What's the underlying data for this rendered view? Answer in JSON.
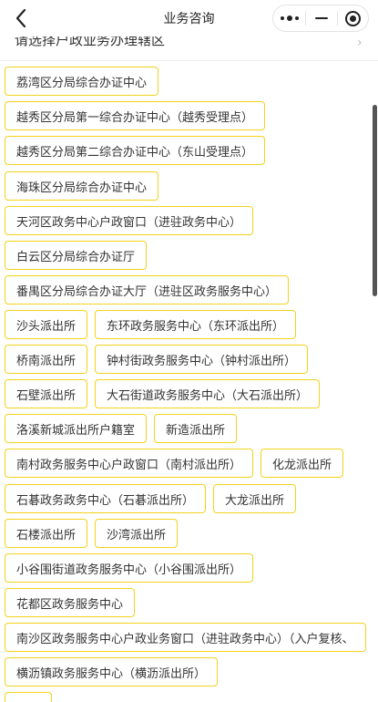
{
  "nav": {
    "title": "业务咨询"
  },
  "prompt": {
    "text": "请选择户政业务办理辖区",
    "arrow": "›"
  },
  "offices": [
    [
      "荔湾区分局综合办证中心"
    ],
    [
      "越秀区分局第一综合办证中心（越秀受理点）"
    ],
    [
      "越秀区分局第二综合办证中心（东山受理点）"
    ],
    [
      "海珠区分局综合办证中心"
    ],
    [
      "天河区政务中心户政窗口（进驻政务中心）"
    ],
    [
      "白云区分局综合办证厅"
    ],
    [
      "番禺区分局综合办证大厅（进驻区政务服务中心）"
    ],
    [
      "沙头派出所",
      "东环政务服务中心（东环派出所）"
    ],
    [
      "桥南派出所",
      "钟村街政务服务中心（钟村派出所）"
    ],
    [
      "石壁派出所",
      "大石街道政务服务中心（大石派出所）"
    ],
    [
      "洛溪新城派出所户籍室",
      "新造派出所"
    ],
    [
      "南村政务服务中心户政窗口（南村派出所）",
      "化龙派出所"
    ],
    [
      "石碁政务政务中心（石碁派出所）",
      "大龙派出所"
    ],
    [
      "石楼派出所",
      "沙湾派出所"
    ],
    [
      "小谷围街道政务服务中心（小谷围派出所）"
    ],
    [
      "花都区政务服务中心"
    ],
    [
      "南沙区政务服务中心户政业务窗口（进驻政务中心）（入户复核、"
    ],
    [
      "横沥镇政务服务中心（横沥派出所）"
    ],
    [
      "……"
    ]
  ],
  "colors": {
    "chip_border": "#f3d21c",
    "text": "#333333",
    "scrollbar": "#555555"
  },
  "icons": {
    "back": "chevron-left-icon",
    "more": "more-dots-icon",
    "minimize": "minus-icon",
    "close": "target-circle-icon",
    "prompt_arrow": "chevron-right-icon"
  }
}
